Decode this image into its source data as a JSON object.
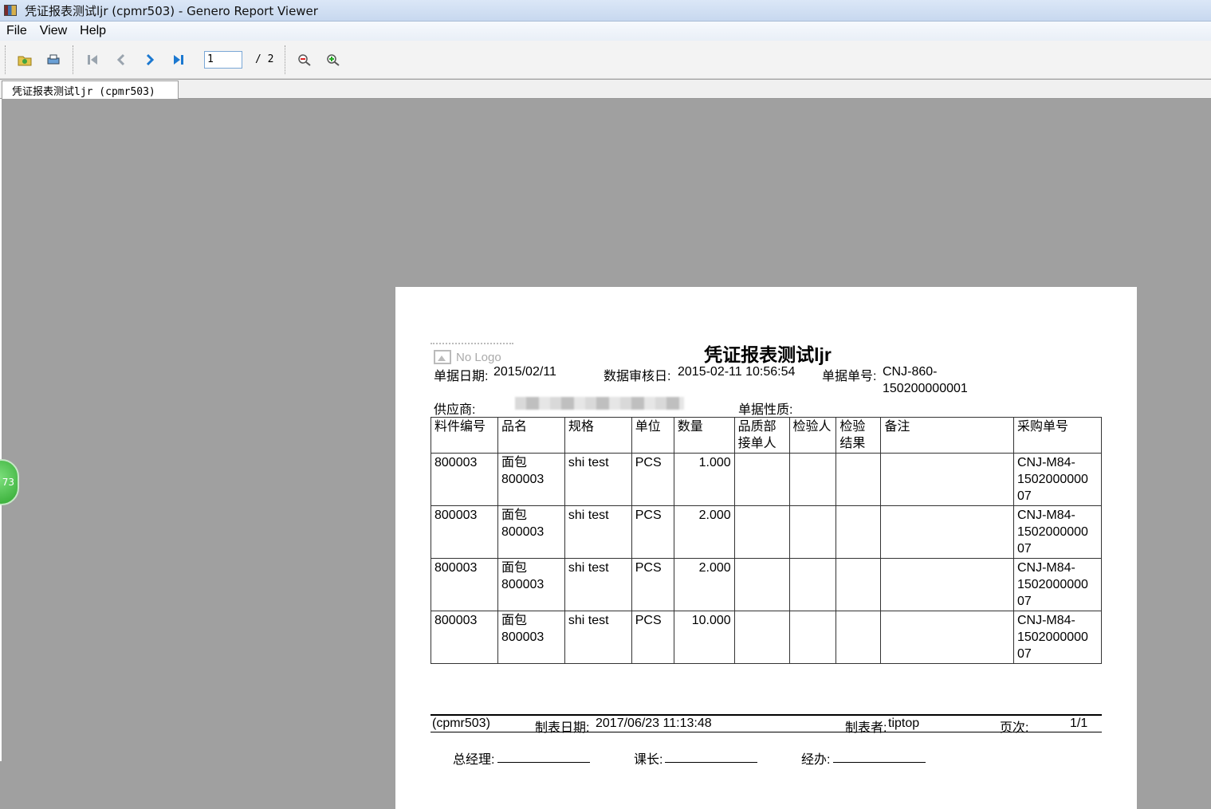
{
  "window": {
    "title": "凭证报表测试ljr (cpmr503) - Genero Report Viewer"
  },
  "menu": {
    "items": [
      "File",
      "View",
      "Help"
    ]
  },
  "toolbar": {
    "page_value": "1",
    "page_total": "/ 2"
  },
  "tab": {
    "label": "凭证报表测试ljr (cpmr503)"
  },
  "floating_badge": {
    "text": "73"
  },
  "report": {
    "logo_placeholder": "No Logo",
    "title": "凭证报表测试ljr",
    "doc_date_label": "单据日期:",
    "doc_date": "2015/02/11",
    "audit_date_label": "数据审核日:",
    "audit_date": "2015-02-11 10:56:54",
    "doc_no_label": "单据单号:",
    "doc_no_line1": "CNJ-860-",
    "doc_no_line2": "150200000001",
    "supplier_label": "供应商:",
    "doc_nature_label": "单据性质:",
    "table": {
      "headers": [
        "料件编号",
        "品名",
        "规格",
        "单位",
        "数量",
        "品质部\n接单人",
        "检验人",
        "检验\n结果",
        "备注",
        "采购单号"
      ],
      "rows": [
        [
          "800003",
          "面包\n800003",
          "shi test",
          "PCS",
          "1.000",
          "",
          "",
          "",
          "",
          "CNJ-M84-\n1502000000\n07"
        ],
        [
          "800003",
          "面包\n800003",
          "shi test",
          "PCS",
          "2.000",
          "",
          "",
          "",
          "",
          "CNJ-M84-\n1502000000\n07"
        ],
        [
          "800003",
          "面包\n800003",
          "shi test",
          "PCS",
          "2.000",
          "",
          "",
          "",
          "",
          "CNJ-M84-\n1502000000\n07"
        ],
        [
          "800003",
          "面包\n800003",
          "shi test",
          "PCS",
          "10.000",
          "",
          "",
          "",
          "",
          "CNJ-M84-\n1502000000\n07"
        ]
      ]
    },
    "footer": {
      "program": "(cpmr503)",
      "made_date_label": "制表日期:",
      "made_date": "2017/06/23 11:13:48",
      "maker_label": "制表者:",
      "maker": "tiptop",
      "page_label": "页次:",
      "page": "1/1"
    },
    "signatures": [
      "总经理:",
      "课长:",
      "经办:"
    ]
  }
}
